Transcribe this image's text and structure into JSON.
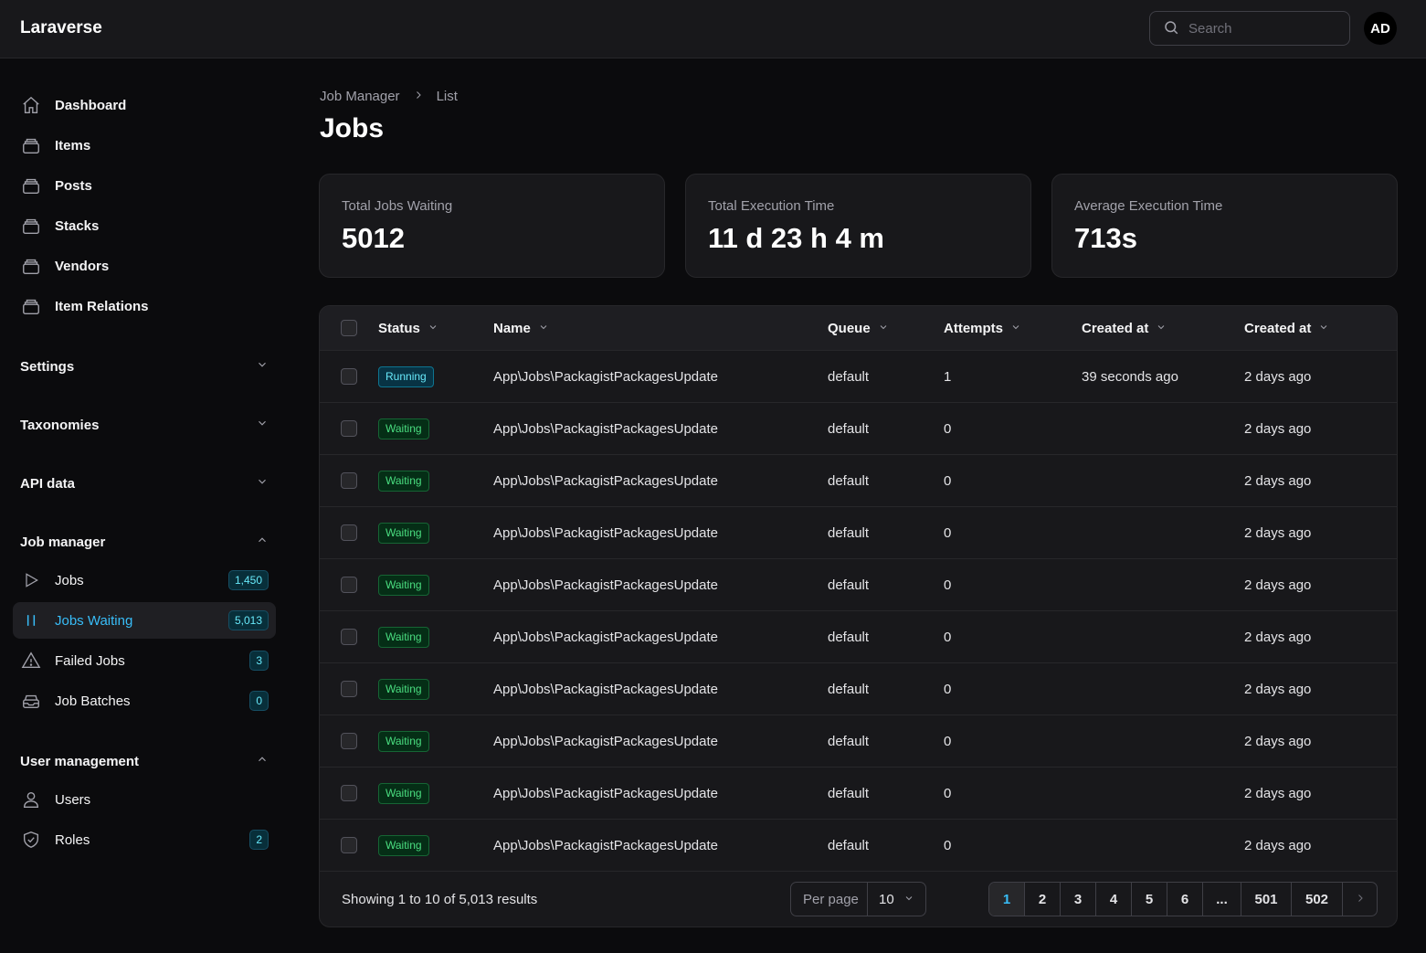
{
  "app": {
    "brand": "Laraverse",
    "avatar_initials": "AD"
  },
  "search": {
    "placeholder": "Search"
  },
  "sidebar": {
    "items": [
      {
        "label": "Dashboard",
        "icon": "home-icon"
      },
      {
        "label": "Items",
        "icon": "stack-icon"
      },
      {
        "label": "Posts",
        "icon": "stack-icon"
      },
      {
        "label": "Stacks",
        "icon": "stack-icon"
      },
      {
        "label": "Vendors",
        "icon": "stack-icon"
      },
      {
        "label": "Item Relations",
        "icon": "stack-icon"
      }
    ],
    "groups": {
      "settings": "Settings",
      "taxonomies": "Taxonomies",
      "api_data": "API data",
      "job_manager": "Job manager",
      "user_management": "User management"
    },
    "job_manager_items": [
      {
        "label": "Jobs",
        "badge": "1,450",
        "icon": "play-icon"
      },
      {
        "label": "Jobs Waiting",
        "badge": "5,013",
        "icon": "pause-icon"
      },
      {
        "label": "Failed Jobs",
        "badge": "3",
        "icon": "warning-icon"
      },
      {
        "label": "Job Batches",
        "badge": "0",
        "icon": "inbox-stack-icon"
      }
    ],
    "user_items": [
      {
        "label": "Users",
        "icon": "user-icon"
      },
      {
        "label": "Roles",
        "badge": "2",
        "icon": "shield-check-icon"
      }
    ]
  },
  "breadcrumb": {
    "root": "Job Manager",
    "current": "List"
  },
  "page": {
    "title": "Jobs"
  },
  "stats": [
    {
      "label": "Total Jobs Waiting",
      "value": "5012"
    },
    {
      "label": "Total Execution Time",
      "value": "11 d 23 h 4 m"
    },
    {
      "label": "Average Execution Time",
      "value": "713s"
    }
  ],
  "table": {
    "columns": [
      "Status",
      "Name",
      "Queue",
      "Attempts",
      "Created at",
      "Created at"
    ],
    "rows": [
      {
        "status": "Running",
        "name": "App\\Jobs\\PackagistPackagesUpdate",
        "queue": "default",
        "attempts": "1",
        "reserved": "39 seconds ago",
        "created": "2 days ago"
      },
      {
        "status": "Waiting",
        "name": "App\\Jobs\\PackagistPackagesUpdate",
        "queue": "default",
        "attempts": "0",
        "reserved": "",
        "created": "2 days ago"
      },
      {
        "status": "Waiting",
        "name": "App\\Jobs\\PackagistPackagesUpdate",
        "queue": "default",
        "attempts": "0",
        "reserved": "",
        "created": "2 days ago"
      },
      {
        "status": "Waiting",
        "name": "App\\Jobs\\PackagistPackagesUpdate",
        "queue": "default",
        "attempts": "0",
        "reserved": "",
        "created": "2 days ago"
      },
      {
        "status": "Waiting",
        "name": "App\\Jobs\\PackagistPackagesUpdate",
        "queue": "default",
        "attempts": "0",
        "reserved": "",
        "created": "2 days ago"
      },
      {
        "status": "Waiting",
        "name": "App\\Jobs\\PackagistPackagesUpdate",
        "queue": "default",
        "attempts": "0",
        "reserved": "",
        "created": "2 days ago"
      },
      {
        "status": "Waiting",
        "name": "App\\Jobs\\PackagistPackagesUpdate",
        "queue": "default",
        "attempts": "0",
        "reserved": "",
        "created": "2 days ago"
      },
      {
        "status": "Waiting",
        "name": "App\\Jobs\\PackagistPackagesUpdate",
        "queue": "default",
        "attempts": "0",
        "reserved": "",
        "created": "2 days ago"
      },
      {
        "status": "Waiting",
        "name": "App\\Jobs\\PackagistPackagesUpdate",
        "queue": "default",
        "attempts": "0",
        "reserved": "",
        "created": "2 days ago"
      },
      {
        "status": "Waiting",
        "name": "App\\Jobs\\PackagistPackagesUpdate",
        "queue": "default",
        "attempts": "0",
        "reserved": "",
        "created": "2 days ago"
      }
    ]
  },
  "footer": {
    "showing": "Showing 1 to 10 of 5,013 results",
    "per_page_label": "Per page",
    "per_page_value": "10",
    "pages": [
      "1",
      "2",
      "3",
      "4",
      "5",
      "6",
      "...",
      "501",
      "502"
    ],
    "current_page": "1"
  },
  "colors": {
    "accent": "#38bdf8",
    "running": "#67e8f9",
    "waiting": "#4ade80",
    "background": "#0b0b0d",
    "surface": "#18181b"
  }
}
